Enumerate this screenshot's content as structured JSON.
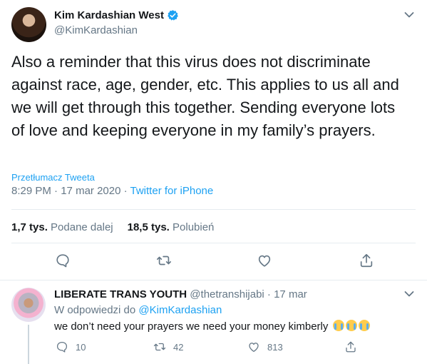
{
  "tweet": {
    "display_name": "Kim Kardashian West",
    "handle": "@KimKardashian",
    "text": "Also a reminder that this virus does not discriminate against race, age, gender, etc. This applies to us all and we will get through this together. Sending everyone lots of love and keeping everyone in my family’s prayers.",
    "translate_label": "Przetłumacz Tweeta",
    "time": "8:29 PM",
    "date": "17 mar 2020",
    "separator": " · ",
    "source": "Twitter for iPhone",
    "retweets_count": "1,7 tys.",
    "retweets_label": "Podane dalej",
    "likes_count": "18,5 tys.",
    "likes_label": "Polubień",
    "verified_color": "#1da1f2"
  },
  "reply": {
    "display_name": "LIBERATE TRANS YOUTH",
    "handle": "@thetranshijabi",
    "dot": "·",
    "date": "17 mar",
    "replying_prefix": "W odpowiedzi do",
    "replying_to": "@KimKardashian",
    "text": "we don’t need your prayers we need your money kimberly",
    "emojis": [
      "loudly-crying-face",
      "loudly-crying-face",
      "loudly-crying-face"
    ],
    "replies_count": "10",
    "retweets_count": "42",
    "likes_count": "813"
  },
  "colors": {
    "accent": "#1da1f2",
    "muted": "#657786",
    "text": "#14171a",
    "border": "#e6ecf0"
  }
}
